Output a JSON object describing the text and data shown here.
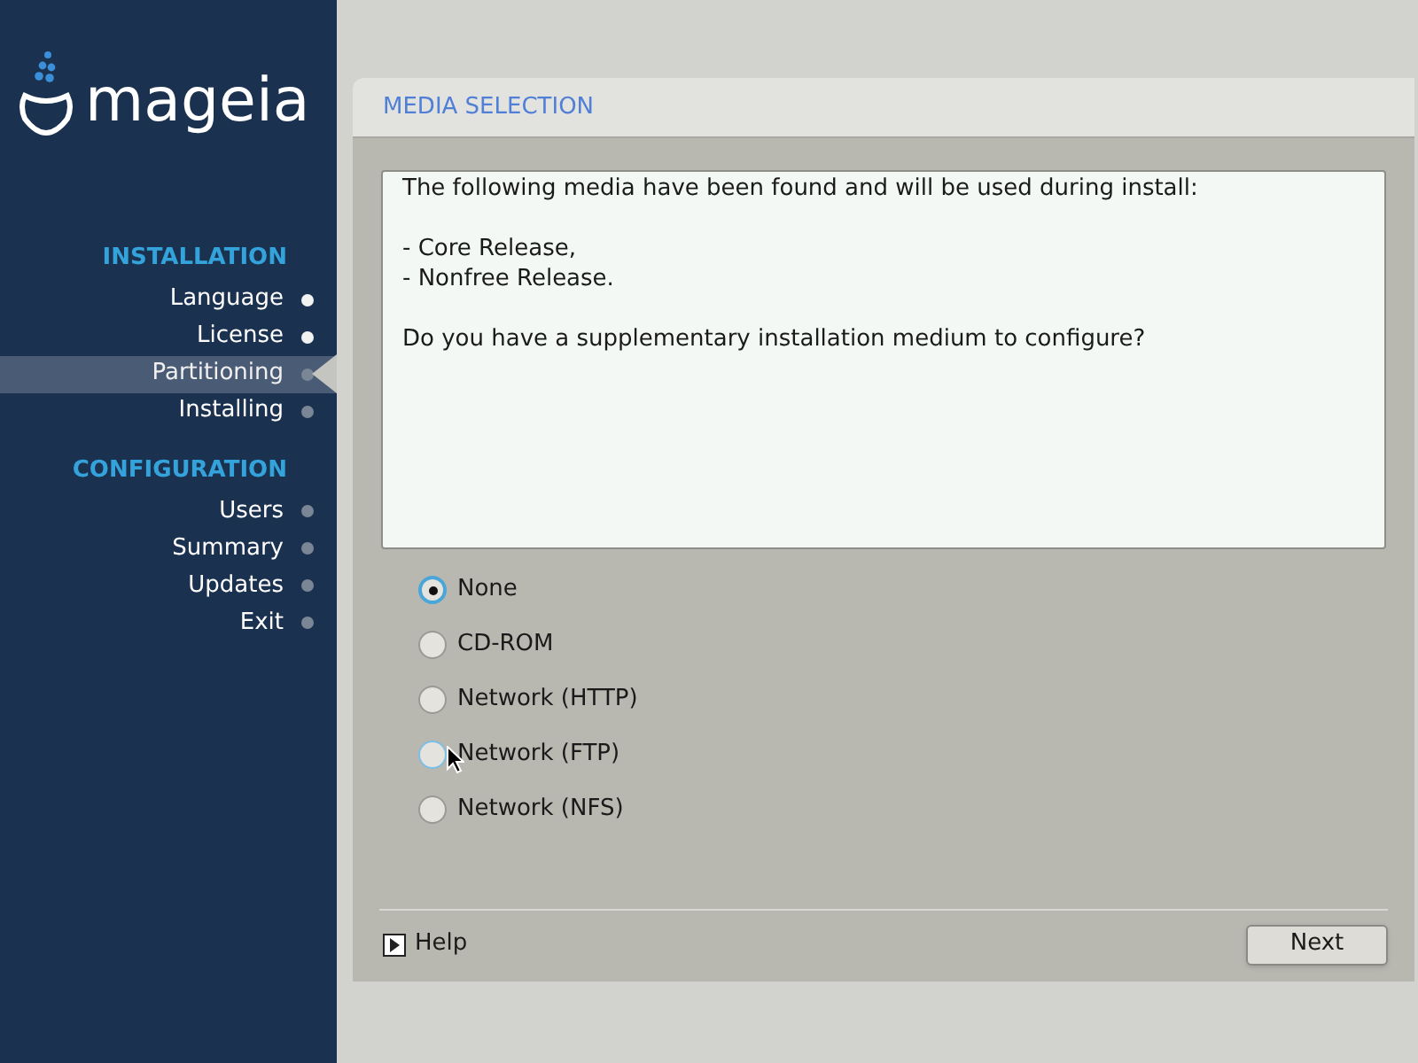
{
  "sidebar": {
    "logo": "mageia",
    "sections": [
      {
        "title": "INSTALLATION",
        "items": [
          {
            "label": "Language",
            "done": true,
            "selected": false
          },
          {
            "label": "License",
            "done": true,
            "selected": false
          },
          {
            "label": "Partitioning",
            "done": false,
            "selected": true
          },
          {
            "label": "Installing",
            "done": false,
            "selected": false
          }
        ]
      },
      {
        "title": "CONFIGURATION",
        "items": [
          {
            "label": "Users",
            "done": false,
            "selected": false
          },
          {
            "label": "Summary",
            "done": false,
            "selected": false
          },
          {
            "label": "Updates",
            "done": false,
            "selected": false
          },
          {
            "label": "Exit",
            "done": false,
            "selected": false
          }
        ]
      }
    ]
  },
  "panel": {
    "title": "MEDIA SELECTION",
    "message": [
      "The following media have been found and will be used during install:",
      "- Core Release,",
      "- Nonfree Release.",
      "Do you have a supplementary installation medium to configure?"
    ],
    "options": [
      {
        "label": "None",
        "selected": true,
        "hovered": false
      },
      {
        "label": "CD-ROM",
        "selected": false,
        "hovered": false
      },
      {
        "label": "Network (HTTP)",
        "selected": false,
        "hovered": false
      },
      {
        "label": "Network (FTP)",
        "selected": false,
        "hovered": true
      },
      {
        "label": "Network (NFS)",
        "selected": false,
        "hovered": false
      }
    ],
    "help": "Help",
    "next": "Next"
  }
}
